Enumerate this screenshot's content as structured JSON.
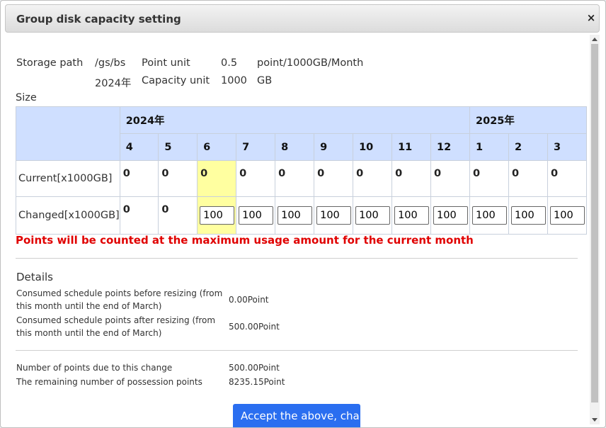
{
  "dialog": {
    "title": "Group disk capacity setting",
    "close_label": "×"
  },
  "info": {
    "storage_path_label": "Storage path",
    "storage_path_value": "/gs/bs",
    "point_unit_label": "Point unit",
    "point_unit_value": "0.5",
    "point_unit_suffix": "point/1000GB/Month",
    "year": "2024年",
    "capacity_unit_label": "Capacity unit",
    "capacity_unit_value": "1000",
    "capacity_unit_suffix": "GB",
    "size_label": "Size"
  },
  "table": {
    "year1": "2024年",
    "year2": "2025年",
    "months": [
      "4",
      "5",
      "6",
      "7",
      "8",
      "9",
      "10",
      "11",
      "12",
      "1",
      "2",
      "3"
    ],
    "current_label": "Current[x1000GB]",
    "current": [
      "0",
      "0",
      "0",
      "0",
      "0",
      "0",
      "0",
      "0",
      "0",
      "0",
      "0",
      "0"
    ],
    "changed_label": "Changed[x1000GB]",
    "changed_static": [
      "0",
      "0"
    ],
    "changed_inputs": [
      "100",
      "100",
      "100",
      "100",
      "100",
      "100",
      "100",
      "100",
      "100",
      "100"
    ]
  },
  "warning": "Points will be counted at the maximum usage amount for the current month",
  "details": {
    "title": "Details",
    "before_label_line1": "Consumed schedule points before resizing (from",
    "before_label_line2": "this month until the end of March)",
    "before_value": "0.00Point",
    "after_label_line1": "Consumed schedule points after resizing (from",
    "after_label_line2": "this month until the end of March)",
    "after_value": "500.00Point",
    "change_label": "Number of points due to this change",
    "change_value": "500.00Point",
    "remaining_label": "The remaining number of possession points",
    "remaining_value": "8235.15Point"
  },
  "accept_button": "Accept the above, cha"
}
